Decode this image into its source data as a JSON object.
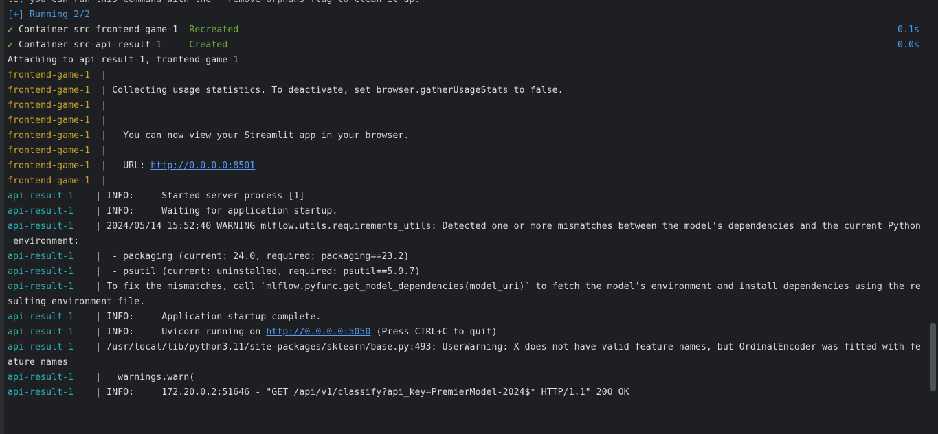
{
  "header_cut": "te, you can run this command with the --remove-orphans flag to clean it up.",
  "running": "[+] Running 2/2",
  "containers": [
    {
      "check": "✔",
      "name": "Container src-frontend-game-1",
      "status": "Recreated",
      "time": "0.1s"
    },
    {
      "check": "✔",
      "name": "Container src-api-result-1   ",
      "status": "Created",
      "time": "0.0s"
    }
  ],
  "attaching": "Attaching to api-result-1, frontend-game-1",
  "prefix_frontend": "frontend-game-1",
  "prefix_api": "api-result-1   ",
  "pipe": "|",
  "lines": [
    {
      "text": ""
    },
    {
      "text": "Collecting usage statistics. To deactivate, set browser.gatherUsageStats to false."
    },
    {
      "text": ""
    },
    {
      "text": ""
    },
    {
      "text": "  You can now view your Streamlit app in your browser."
    },
    {
      "text": ""
    },
    {
      "text": "  URL: ",
      "link": "http://0.0.0.0:8501"
    },
    {
      "text": ""
    },
    {
      "text": "INFO:     Started server process [1]"
    },
    {
      "text": "INFO:     Waiting for application startup."
    },
    {
      "text": "2024/05/14 15:52:40 WARNING mlflow.utils.requirements_utils: Detected one or more mismatches between the model's dependencies and the current Python",
      "cont": " environment:"
    },
    {
      "text": " - packaging (current: 24.0, required: packaging==23.2)"
    },
    {
      "text": " - psutil (current: uninstalled, required: psutil==5.9.7)"
    },
    {
      "text": "To fix the mismatches, call `mlflow.pyfunc.get_model_dependencies(model_uri)` to fetch the model's environment and install dependencies using the re",
      "cont": "sulting environment file."
    },
    {
      "text": "INFO:     Application startup complete."
    },
    {
      "text": "INFO:     Uvicorn running on ",
      "link": "http://0.0.0.0:5050",
      "after": " (Press CTRL+C to quit)"
    },
    {
      "text": "/usr/local/lib/python3.11/site-packages/sklearn/base.py:493: UserWarning: X does not have valid feature names, but OrdinalEncoder was fitted with fe",
      "cont": "ature names"
    },
    {
      "text": "  warnings.warn("
    },
    {
      "text": "INFO:     172.20.0.2:51646 - \"GET /api/v1/classify?api_key=PremierModel-2024$* HTTP/1.1\" 200 OK"
    }
  ]
}
